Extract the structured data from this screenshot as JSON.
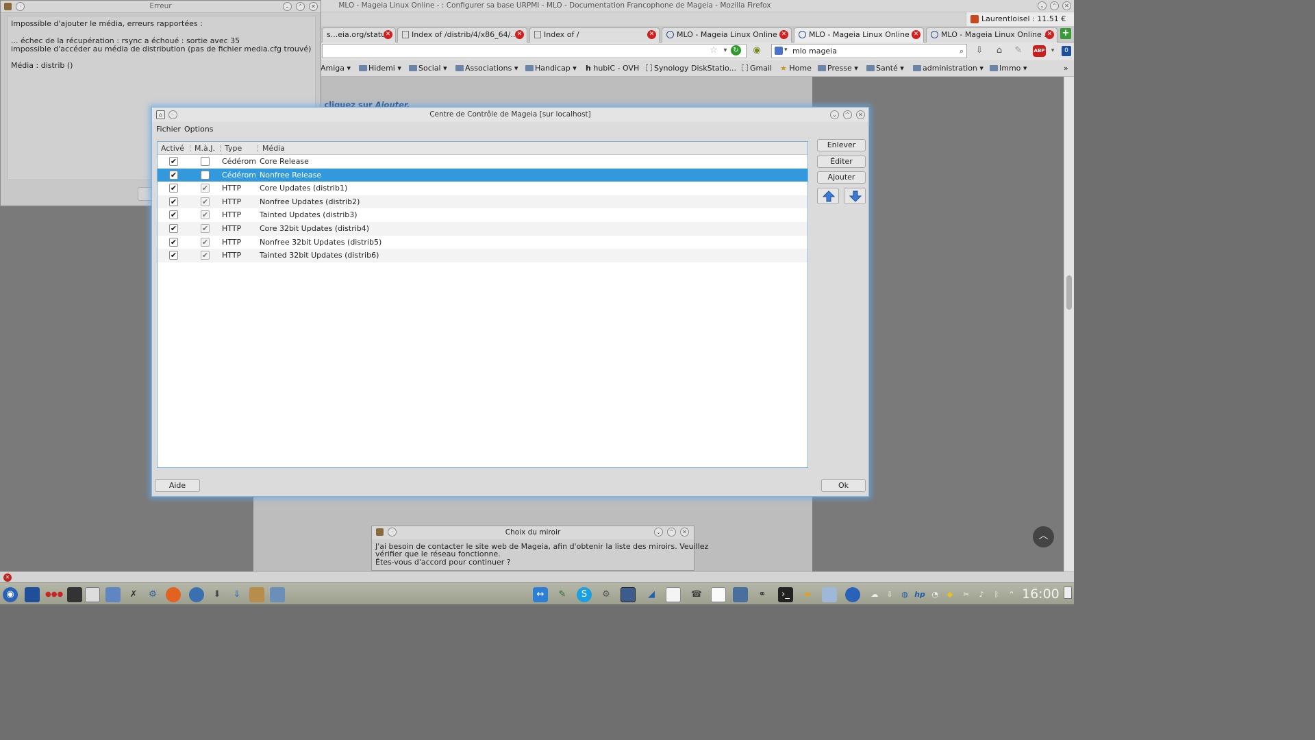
{
  "firefox": {
    "window_title": "MLO - Mageia Linux Online - : Configurer sa base URPMI - MLO - Documentation Francophone de Mageia - Mozilla Firefox",
    "user_label": "Laurentloisel : 11.51 €",
    "tabs": [
      {
        "label": "s...eia.org/status"
      },
      {
        "label": "Index of /distrib/4/x86_64/..."
      },
      {
        "label": "Index of /"
      },
      {
        "label": "MLO - Mageia Linux Online ..."
      },
      {
        "label": "MLO - Mageia Linux Online ..."
      },
      {
        "label": "MLO - Mageia Linux Online ..."
      }
    ],
    "new_tab": "+",
    "search_value": "mlo mageia",
    "abp_label": "ABP",
    "badge_count": "0",
    "bookmarks": [
      {
        "label": "Amiga"
      },
      {
        "label": "Hidemi"
      },
      {
        "label": "Social"
      },
      {
        "label": "Associations"
      },
      {
        "label": "Handicap"
      },
      {
        "label": "hubiC - OVH"
      },
      {
        "label": "Synology DiskStatio..."
      },
      {
        "label": "Gmail"
      },
      {
        "label": "Home"
      },
      {
        "label": "Presse"
      },
      {
        "label": "Santé"
      },
      {
        "label": "administration"
      },
      {
        "label": "Immo"
      }
    ],
    "page_text_prefix": ", cliquez sur ",
    "page_text_link": "Ajouter."
  },
  "error_window": {
    "title": "Erreur",
    "line1": "Impossible d'ajouter le média, erreurs rapportées :",
    "line2": "... échec de la récupération : rsync a échoué : sortie avec 35",
    "line3": "impossible d'accéder au média de distribution (pas de fichier media.cfg trouvé)",
    "line4": "Média : distrib ()"
  },
  "mcc": {
    "title": "Centre de Contrôle de Mageia  [sur localhost]",
    "menu": {
      "file": "Fichier",
      "options": "Options"
    },
    "columns": {
      "active": "Activé",
      "update": "M.à.J.",
      "type": "Type",
      "media": "Média"
    },
    "rows": [
      {
        "active": "✔",
        "update": "",
        "type": "Cédérom",
        "media": "Core Release"
      },
      {
        "active": "✔",
        "update": "",
        "type": "Cédérom",
        "media": "Nonfree Release"
      },
      {
        "active": "✔",
        "update": "✔",
        "type": "HTTP",
        "media": "Core Updates (distrib1)"
      },
      {
        "active": "✔",
        "update": "✔",
        "type": "HTTP",
        "media": "Nonfree Updates (distrib2)"
      },
      {
        "active": "✔",
        "update": "✔",
        "type": "HTTP",
        "media": "Tainted Updates (distrib3)"
      },
      {
        "active": "✔",
        "update": "✔",
        "type": "HTTP",
        "media": "Core 32bit Updates (distrib4)"
      },
      {
        "active": "✔",
        "update": "✔",
        "type": "HTTP",
        "media": "Nonfree 32bit Updates (distrib5)"
      },
      {
        "active": "✔",
        "update": "✔",
        "type": "HTTP",
        "media": "Tainted 32bit Updates (distrib6)"
      }
    ],
    "selected_row": "Nonfree Release",
    "buttons": {
      "remove": "Enlever",
      "edit": "Éditer",
      "add": "Ajouter",
      "help": "Aide",
      "ok": "Ok"
    }
  },
  "mirror_dialog": {
    "title": "Choix du miroir",
    "line1": "J'ai besoin de contacter le site web de Mageia, afin d'obtenir la liste des miroirs. Veuillez",
    "line2": "vérifier que le réseau fonctionne.",
    "line3": "Êtes-vous d'accord pour continuer ?"
  },
  "taskbar": {
    "clock": "16:00"
  },
  "colors": {
    "selection": "#3399dd",
    "focus_glow": "#7fb6e3",
    "error_red": "#d21f1f"
  }
}
